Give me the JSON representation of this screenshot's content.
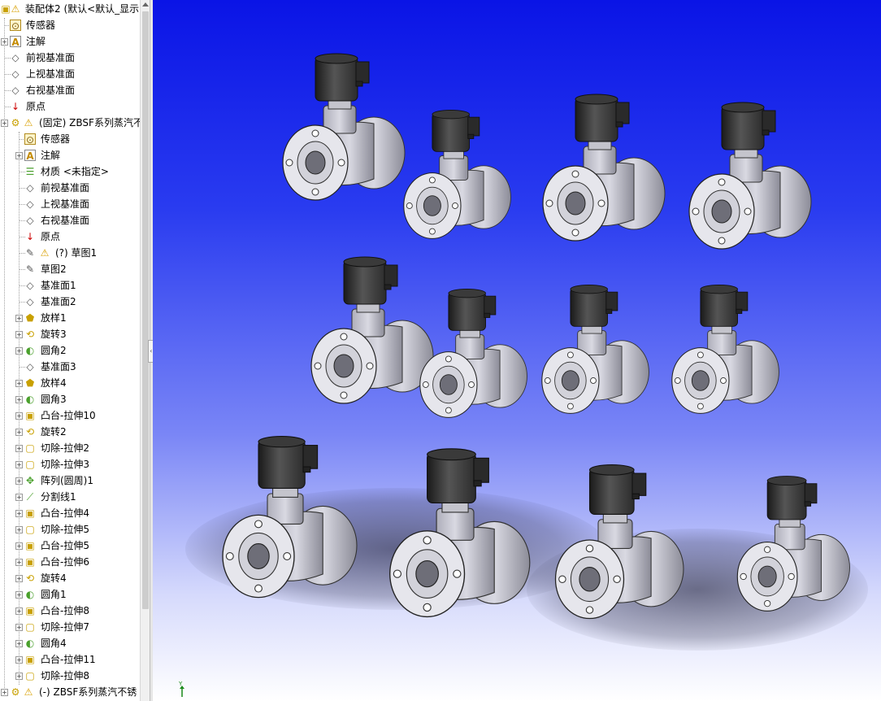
{
  "tree": {
    "root": {
      "label": "装配体2 (默认<默认_显示"
    },
    "items": [
      {
        "label": "传感器",
        "icon": "sensor-icon"
      },
      {
        "label": "注解",
        "icon": "annotation-icon"
      },
      {
        "label": "前视基准面",
        "icon": "plane-icon"
      },
      {
        "label": "上视基准面",
        "icon": "plane-icon"
      },
      {
        "label": "右视基准面",
        "icon": "plane-icon"
      },
      {
        "label": "原点",
        "icon": "origin-icon"
      },
      {
        "label": "(固定) ZBSF系列蒸汽不",
        "icon": "part-icon"
      },
      {
        "label": "传感器",
        "icon": "sensor-icon"
      },
      {
        "label": "注解",
        "icon": "annotation-icon"
      },
      {
        "label": "材质 <未指定>",
        "icon": "material-icon"
      },
      {
        "label": "前视基准面",
        "icon": "plane-icon"
      },
      {
        "label": "上视基准面",
        "icon": "plane-icon"
      },
      {
        "label": "右视基准面",
        "icon": "plane-icon"
      },
      {
        "label": "原点",
        "icon": "origin-icon"
      },
      {
        "label": "(?) 草图1",
        "icon": "sketch-icon"
      },
      {
        "label": "草图2",
        "icon": "sketch-icon"
      },
      {
        "label": "基准面1",
        "icon": "plane-icon"
      },
      {
        "label": "基准面2",
        "icon": "plane-icon"
      },
      {
        "label": "放样1",
        "icon": "loft-icon"
      },
      {
        "label": "旋转3",
        "icon": "revolve-icon"
      },
      {
        "label": "圆角2",
        "icon": "fillet-icon"
      },
      {
        "label": "基准面3",
        "icon": "plane-icon"
      },
      {
        "label": "放样4",
        "icon": "loft-icon"
      },
      {
        "label": "圆角3",
        "icon": "fillet-icon"
      },
      {
        "label": "凸台-拉伸10",
        "icon": "boss-extrude-icon"
      },
      {
        "label": "旋转2",
        "icon": "revolve-icon"
      },
      {
        "label": "切除-拉伸2",
        "icon": "cut-extrude-icon"
      },
      {
        "label": "切除-拉伸3",
        "icon": "cut-extrude-icon"
      },
      {
        "label": "阵列(圆周)1",
        "icon": "circular-pattern-icon"
      },
      {
        "label": "分割线1",
        "icon": "split-line-icon"
      },
      {
        "label": "凸台-拉伸4",
        "icon": "boss-extrude-icon"
      },
      {
        "label": "切除-拉伸5",
        "icon": "cut-extrude-icon"
      },
      {
        "label": "凸台-拉伸5",
        "icon": "boss-extrude-icon"
      },
      {
        "label": "凸台-拉伸6",
        "icon": "boss-extrude-icon"
      },
      {
        "label": "旋转4",
        "icon": "revolve-icon"
      },
      {
        "label": "圆角1",
        "icon": "fillet-icon"
      },
      {
        "label": "凸台-拉伸8",
        "icon": "boss-extrude-icon"
      },
      {
        "label": "切除-拉伸7",
        "icon": "cut-extrude-icon"
      },
      {
        "label": "圆角4",
        "icon": "fillet-icon"
      },
      {
        "label": "凸台-拉伸11",
        "icon": "boss-extrude-icon"
      },
      {
        "label": "切除-拉伸8",
        "icon": "cut-extrude-icon"
      },
      {
        "label": "(-) ZBSF系列蒸汽不锈",
        "icon": "part-icon"
      }
    ]
  },
  "viewport": {
    "axis_label": "Y",
    "colors": {
      "top": "#0a14e6",
      "bottom": "#ffffff",
      "valve_body": "#d9d9e2",
      "solenoid": "#2c2c2c"
    }
  }
}
